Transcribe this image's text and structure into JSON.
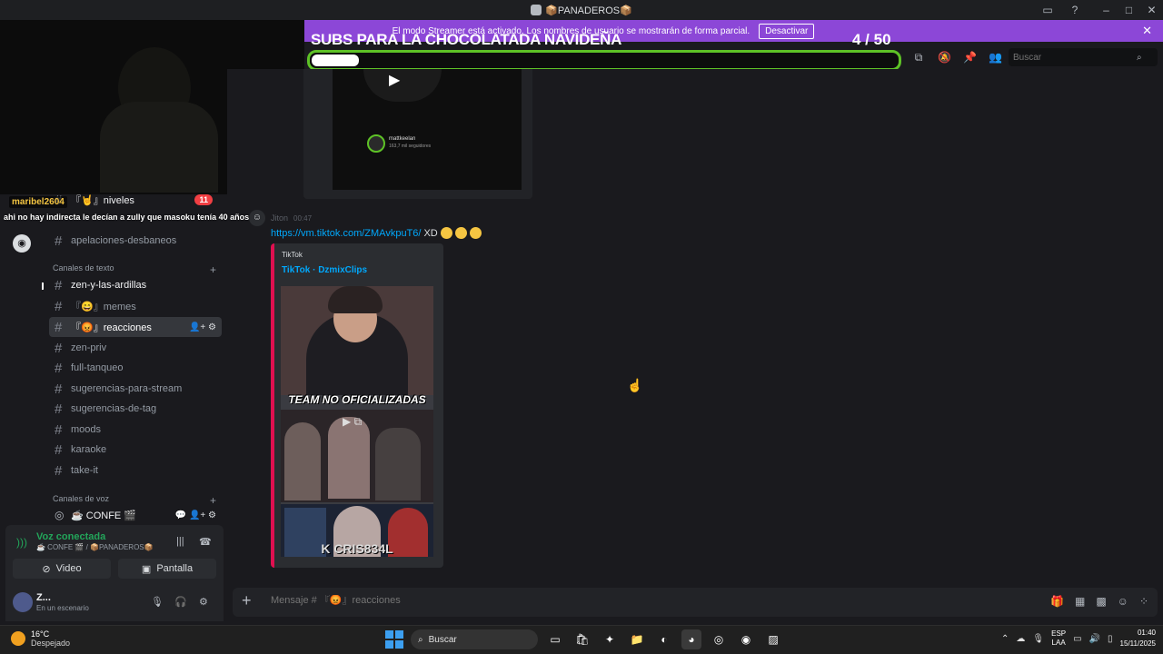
{
  "window": {
    "title": "📦PANADEROS📦"
  },
  "streamer_banner": {
    "message": "El modo Streamer está activado. Los nombres de usuario se mostrarán de forma parcial.",
    "button": "Desactivar"
  },
  "subs_goal": {
    "title": "SUBS PARA LA CHOCOLATADA NAVIDEÑA",
    "current": 4,
    "target": 50,
    "count_text": "4  / 50",
    "fill_fraction": 0.08,
    "bar_color": "#5ec226"
  },
  "header": {
    "search_placeholder": "Buscar"
  },
  "sidebar": {
    "top_items": [
      {
        "label": "『🤘』niveles",
        "badge": "11"
      },
      {
        "label": "apelaciones-desbaneos"
      }
    ],
    "text_category": "Canales de texto",
    "text_channels": [
      {
        "label": "zen-y-las-ardillas",
        "state": "unread"
      },
      {
        "label": "『😄』memes",
        "state": "normal"
      },
      {
        "label": "『😡』reacciones",
        "state": "active"
      },
      {
        "label": "zen-priv",
        "state": "normal"
      },
      {
        "label": "full-tanqueo",
        "state": "normal"
      },
      {
        "label": "sugerencias-para-stream",
        "state": "normal"
      },
      {
        "label": "sugerencias-de-tag",
        "state": "normal"
      },
      {
        "label": "moods",
        "state": "normal"
      },
      {
        "label": "karaoke",
        "state": "normal"
      },
      {
        "label": "take-it",
        "state": "normal"
      }
    ],
    "voice_category": "Canales de voz",
    "voice_channel": "☕ CONFE 🎬"
  },
  "voice_panel": {
    "status": "Voz conectada",
    "location": "☕ CONFE 🎬 / 📦PANADEROS📦",
    "video_label": "Video",
    "screen_label": "Pantalla"
  },
  "user_panel": {
    "name": "Z...",
    "status": "En un escenario"
  },
  "stream_chat_overlay": {
    "username": "maribel2604",
    "message": "ahi no hay indirecta le decían a zully que masoku tenía 40 años"
  },
  "previous_embed": {
    "tiktok_user": "mattkeelan",
    "tiktok_followers": "163,7 mil seguidores"
  },
  "message": {
    "author": "Jiton",
    "time": "00:47",
    "link": "https://vm.tiktok.com/ZMAvkpuT6/",
    "text": "XD",
    "embed": {
      "provider": "TikTok",
      "title": "TikTok · DzmixClips",
      "video_caption": "TEAM NO OFICIALIZADAS",
      "video_tag": "K CRIS834L"
    }
  },
  "composer": {
    "placeholder": "Mensaje # 『😡』reacciones"
  },
  "taskbar": {
    "temperature": "16°C",
    "weather": "Despejado",
    "search_label": "Buscar",
    "lang_line1": "ESP",
    "lang_line2": "LAA",
    "time": "01:40",
    "date": "15/11/2025"
  }
}
